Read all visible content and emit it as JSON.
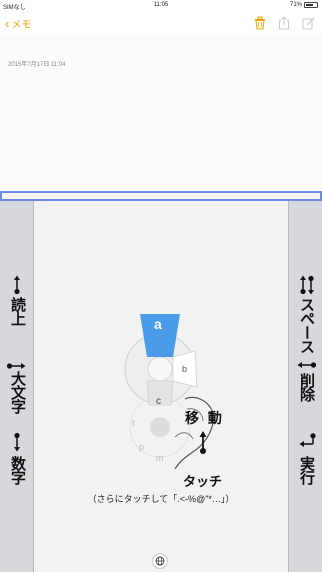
{
  "status_bar": {
    "carrier": "SIMなし",
    "time": "11:05",
    "battery": "71%",
    "battery_level": 0.71
  },
  "nav_bar": {
    "back_label": "メモ",
    "back_icon": "chevron-left-icon",
    "actions": [
      "trash-icon",
      "share-icon",
      "compose-icon"
    ],
    "accent_color": "#e8a500"
  },
  "note": {
    "date": "2015年7月17日 11:04"
  },
  "keyboard": {
    "left_labels": {
      "read_up": "読上",
      "case": "大文字",
      "number": "数字"
    },
    "right_labels": {
      "space": "スペース",
      "delete": "削除",
      "enter": "実行"
    },
    "dial": {
      "top_key": "a",
      "right_key": "b",
      "center_key": "c",
      "faded_left": "t",
      "faded_bottom": "m",
      "faded_left2": "p",
      "highlight_color": "#4a9be8"
    },
    "gesture_move_label": "移 動",
    "gesture_touch_label": "タッチ",
    "hint": "（さらにタッチして「.<-%@\"*…」）"
  }
}
